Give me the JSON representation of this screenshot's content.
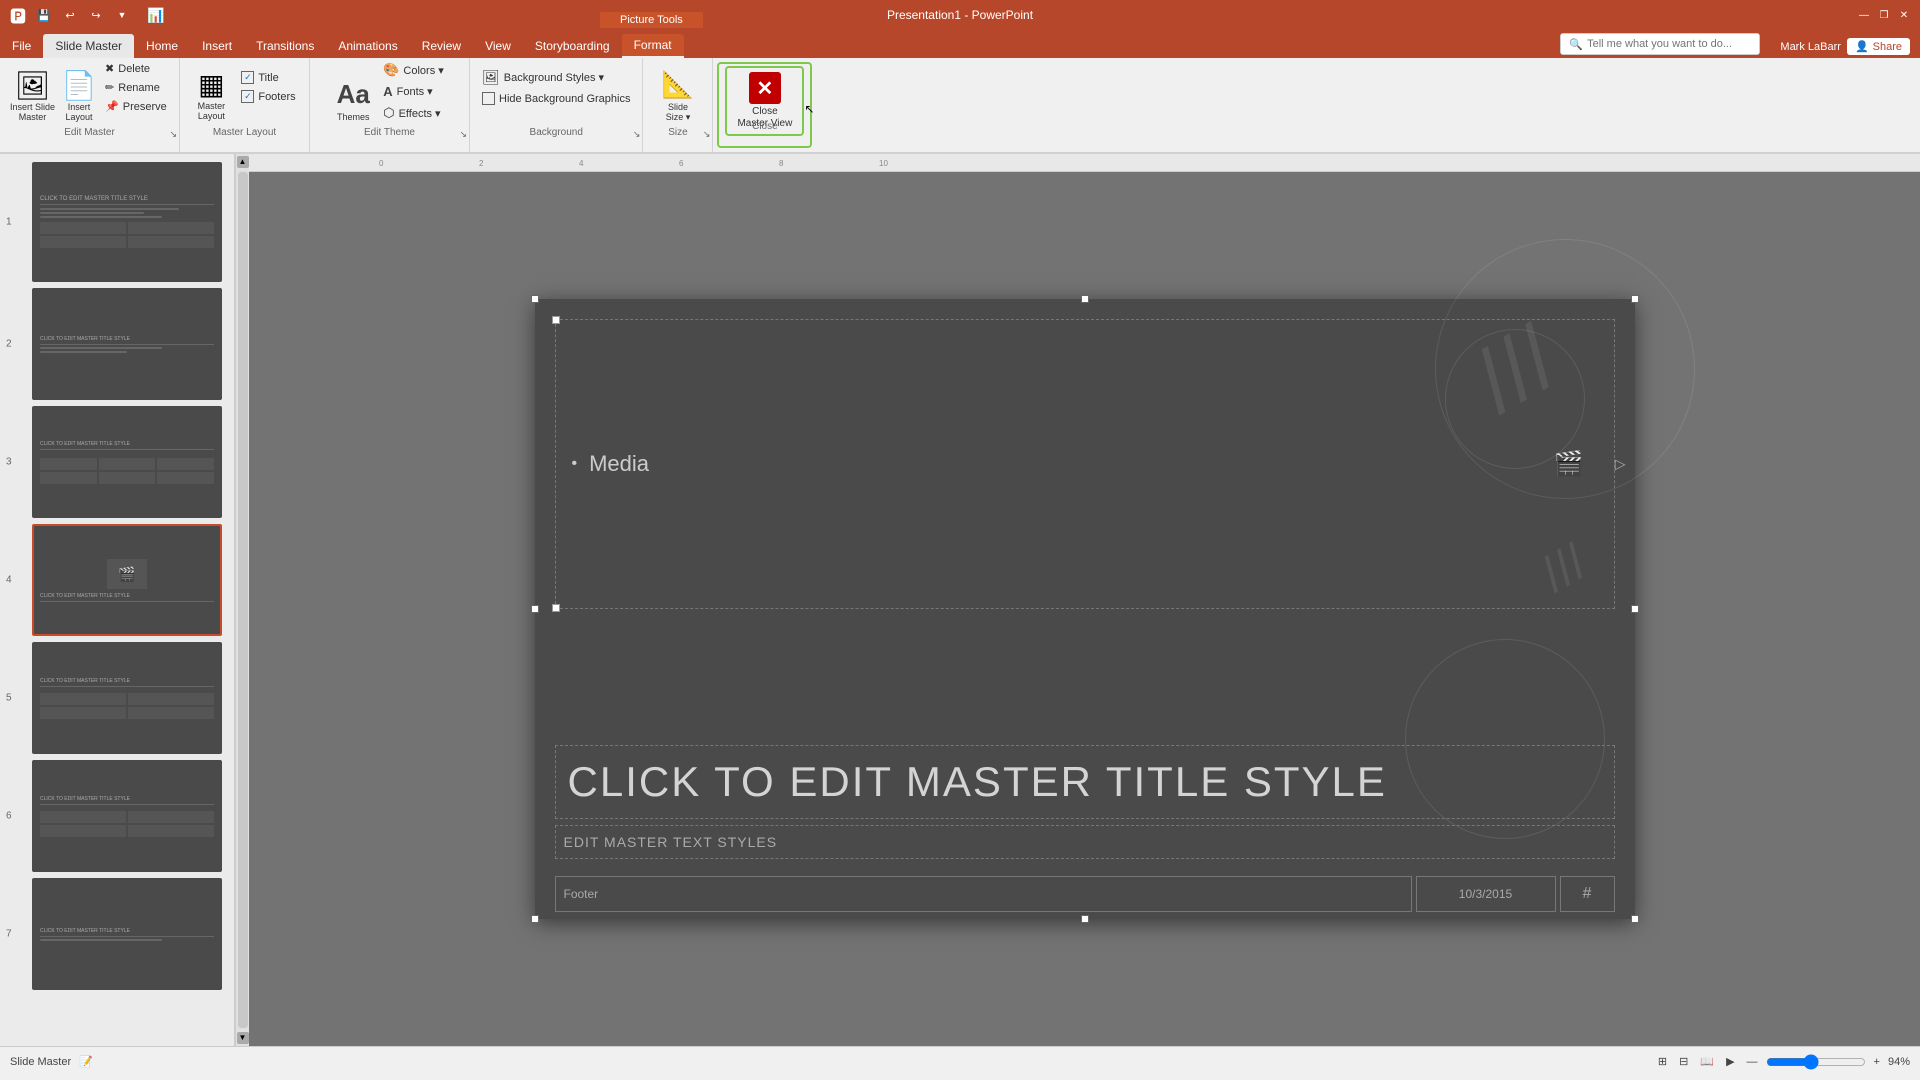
{
  "app": {
    "title": "Presentation1 - PowerPoint",
    "picture_tools_label": "Picture Tools",
    "window_controls": [
      "minimize",
      "restore",
      "close"
    ]
  },
  "quick_access": [
    "save",
    "undo",
    "redo",
    "customize"
  ],
  "tabs": [
    {
      "id": "file",
      "label": "File"
    },
    {
      "id": "slide-master",
      "label": "Slide Master",
      "active": true
    },
    {
      "id": "home",
      "label": "Home"
    },
    {
      "id": "insert",
      "label": "Insert"
    },
    {
      "id": "transitions",
      "label": "Transitions"
    },
    {
      "id": "animations",
      "label": "Animations"
    },
    {
      "id": "review",
      "label": "Review"
    },
    {
      "id": "view",
      "label": "View"
    },
    {
      "id": "storyboarding",
      "label": "Storyboarding"
    },
    {
      "id": "format",
      "label": "Format"
    }
  ],
  "ribbon": {
    "groups": [
      {
        "id": "edit-master",
        "label": "Edit Master",
        "buttons": [
          {
            "id": "insert-slide-master",
            "label": "Insert Slide\nMaster",
            "icon": "🖼"
          },
          {
            "id": "insert-layout",
            "label": "Insert\nLayout",
            "icon": "📄"
          },
          {
            "id": "delete",
            "label": "Delete",
            "icon": "✖"
          },
          {
            "id": "rename",
            "label": "Rename",
            "icon": "✏"
          },
          {
            "id": "preserve",
            "label": "Preserve",
            "icon": "📌"
          }
        ]
      },
      {
        "id": "master-layout",
        "label": "Master Layout",
        "buttons": [
          {
            "id": "master-layout-btn",
            "label": "Master\nLayout",
            "icon": "▦"
          }
        ],
        "checkboxes": [
          {
            "id": "title-chk",
            "label": "Title",
            "checked": true
          },
          {
            "id": "footers-chk",
            "label": "Footers",
            "checked": true
          }
        ]
      },
      {
        "id": "edit-theme",
        "label": "Edit Theme",
        "buttons": [
          {
            "id": "themes",
            "label": "Themes",
            "icon": "Aa"
          },
          {
            "id": "colors",
            "label": "Colors",
            "icon": "🎨"
          },
          {
            "id": "fonts",
            "label": "Fonts",
            "icon": "A"
          },
          {
            "id": "effects",
            "label": "Effects",
            "icon": "⬡"
          }
        ]
      },
      {
        "id": "background",
        "label": "Background",
        "buttons": [
          {
            "id": "background-styles",
            "label": "Background Styles",
            "icon": "🖼"
          },
          {
            "id": "hide-background-graphics",
            "label": "Hide Background Graphics",
            "checkbox": true
          }
        ]
      },
      {
        "id": "size",
        "label": "Size",
        "buttons": [
          {
            "id": "slide-size",
            "label": "Slide\nSize",
            "icon": "📐"
          }
        ]
      },
      {
        "id": "close",
        "label": "Close",
        "buttons": [
          {
            "id": "close-master-view",
            "label": "Close\nMaster View",
            "icon": "✕"
          }
        ]
      }
    ]
  },
  "search": {
    "placeholder": "Tell me what you want to do..."
  },
  "user": {
    "name": "Mark LaBarr",
    "share_label": "Share"
  },
  "slide_panel": {
    "slides": [
      {
        "num": 1,
        "type": "master",
        "active": false
      },
      {
        "num": 2,
        "type": "layout",
        "active": false
      },
      {
        "num": 3,
        "type": "layout-grid",
        "active": false
      },
      {
        "num": 4,
        "type": "content-image",
        "active": true
      },
      {
        "num": 5,
        "type": "layout-grid2",
        "active": false
      },
      {
        "num": 6,
        "type": "layout-grid3",
        "active": false
      },
      {
        "num": 7,
        "type": "layout-simple",
        "active": false
      }
    ]
  },
  "slide": {
    "media_label": "Media",
    "master_title": "CLICK TO EDIT MASTER TITLE STYLE",
    "master_text": "EDIT MASTER TEXT STYLES",
    "footer": "Footer",
    "date": "10/3/2015",
    "page_num": "#"
  },
  "status_bar": {
    "view": "Slide Master",
    "zoom": "94%",
    "view_icons": [
      "normal",
      "slide-sorter",
      "reading",
      "slideshow"
    ]
  }
}
